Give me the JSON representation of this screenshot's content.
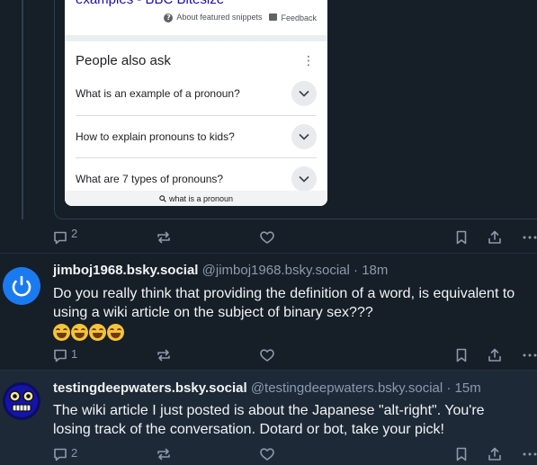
{
  "colors": {
    "background": "#161e27",
    "highlight_background": "#1e2937",
    "muted_text": "#8a9aad",
    "avatar_blue": "#1a7bf0"
  },
  "embed": {
    "snippet_title_partial": "examples - BBC Bitesize",
    "about_snippets_label": "About featured snippets",
    "feedback_label": "Feedback",
    "people_also_ask_title": "People also ask",
    "questions": [
      "What is an example of a pronoun?",
      "How to explain pronouns to kids?",
      "What are 7 types of pronouns?"
    ],
    "search_query": "what is a pronoun",
    "icons": {
      "about": "question-circle-icon",
      "feedback": "feedback-flag-icon",
      "more": "vertical-dots-icon",
      "expand": "chevron-down-icon",
      "search": "search-icon"
    }
  },
  "post_top": {
    "reply_count": "2",
    "repost_count": "",
    "like_count": ""
  },
  "post_1": {
    "display_name": "jimboj1968.bsky.social",
    "handle": "@jimboj1968.bsky.social",
    "separator": "·",
    "time": "18m",
    "text_line1": "Do you really think that providing the definition of a word, is equivalent to",
    "text_line2": "using a wiki article on the subject of binary sex???",
    "emoji": [
      "laughing-tears",
      "laughing-tears",
      "laughing-tears",
      "laughing-tears"
    ],
    "reply_count": "1",
    "avatar_icon": "power-ring-avatar-icon"
  },
  "post_2": {
    "display_name": "testingdeepwaters.bsky.social",
    "handle": "@testingdeepwaters.bsky.social",
    "separator": "·",
    "time": "15m",
    "text_line1": "The wiki article I just posted is about the Japanese \"alt-right\". You're",
    "text_line2": "losing track of the conversation. Dotard or bot, take your pick!",
    "reply_count": "2",
    "avatar_icon": "robot-face-avatar-icon"
  },
  "action_icons": [
    "reply-icon",
    "repost-icon",
    "like-icon",
    "bookmark-icon",
    "share-icon",
    "more-icon"
  ]
}
